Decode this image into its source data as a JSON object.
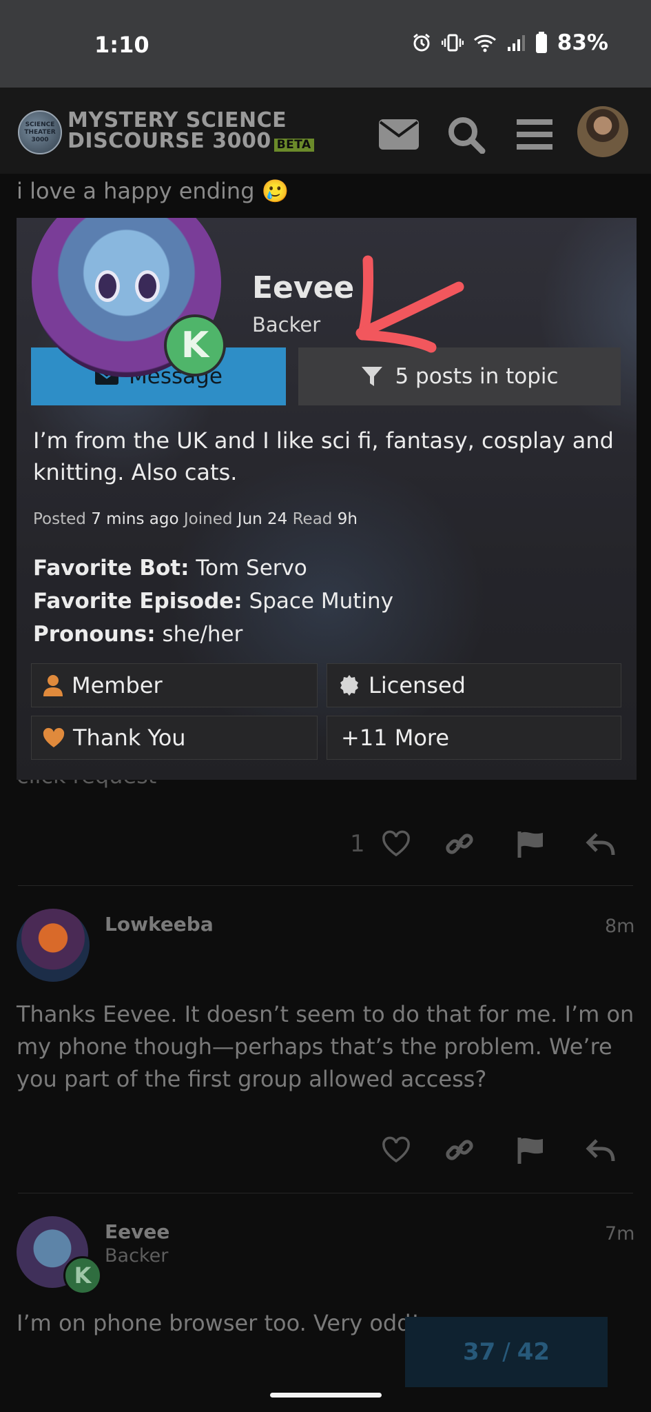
{
  "status_bar": {
    "time": "1:10",
    "battery": "83%"
  },
  "header": {
    "logo_line1": "MYSTERY SCIENCE",
    "logo_line2": "DISCOURSE 3000",
    "beta": "BETA",
    "disc_text": "SCIENCE THEATER 3000",
    "icons": [
      "mail-icon",
      "search-icon",
      "hamburger-menu-icon",
      "user-avatar"
    ]
  },
  "background": {
    "prev_line": "i love a happy ending 🥲",
    "hidden_line": "click request",
    "post1_likes": "1",
    "post2": {
      "author": "Lowkeeba",
      "time": "8m",
      "body": "Thanks Eevee. It doesn’t seem to do that for me. I’m on my phone though—perhaps that’s the problem. We’re you part of the first group allowed access?"
    },
    "post3": {
      "author": "Eevee",
      "title": "Backer",
      "time": "7m",
      "body": "I’m on phone browser too. Very odd!"
    }
  },
  "user_card": {
    "name": "Eevee",
    "title": "Backer",
    "message_label": "Message",
    "filter_label": "5 posts in topic",
    "bio": "I’m from the UK and I like sci fi, fantasy, cosplay and knitting. Also cats.",
    "meta": {
      "posted_label": "Posted",
      "posted_value": "7 mins ago",
      "joined_label": "Joined",
      "joined_value": "Jun 24",
      "read_label": "Read",
      "read_value": "9h"
    },
    "fields": [
      {
        "key": "Favorite Bot:",
        "value": "Tom Servo"
      },
      {
        "key": "Favorite Episode:",
        "value": "Space Mutiny"
      },
      {
        "key": "Pronouns:",
        "value": "she/her"
      }
    ],
    "badges": [
      {
        "label": "Member",
        "icon": "person-icon",
        "color": "#e08a3c"
      },
      {
        "label": "Licensed",
        "icon": "certificate-icon",
        "color": "#d6d6d6"
      },
      {
        "label": "Thank You",
        "icon": "heart-icon",
        "color": "#e08a3c"
      },
      {
        "label": "+11 More",
        "icon": "",
        "color": ""
      }
    ],
    "kickstarter_badge": "K"
  },
  "progress": {
    "current": "37",
    "separator": "/",
    "total": "42"
  },
  "colors": {
    "accent_blue": "#2e8ec7",
    "kickstarter_green": "#4fb56a",
    "annotation_red": "#f2575d"
  }
}
